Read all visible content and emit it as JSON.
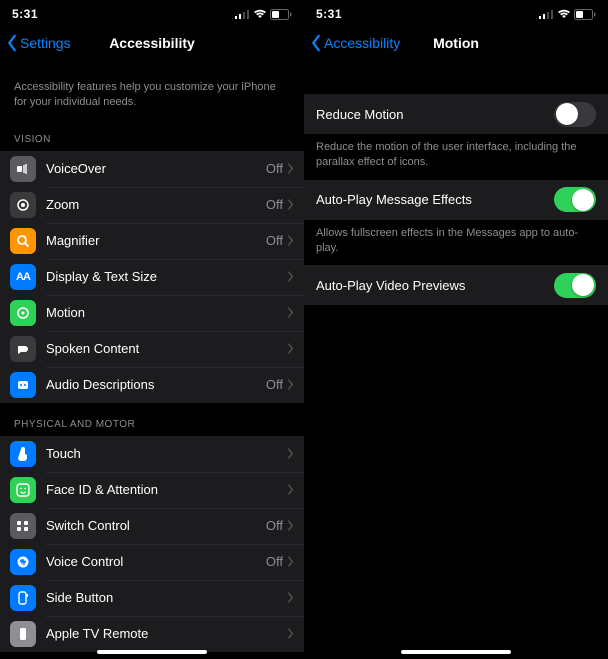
{
  "statusbar": {
    "time": "5:31"
  },
  "left": {
    "back": "Settings",
    "title": "Accessibility",
    "intro": "Accessibility features help you customize your iPhone for your individual needs.",
    "sections": {
      "vision": {
        "header": "VISION",
        "rows": [
          {
            "label": "VoiceOver",
            "value": "Off"
          },
          {
            "label": "Zoom",
            "value": "Off"
          },
          {
            "label": "Magnifier",
            "value": "Off"
          },
          {
            "label": "Display & Text Size",
            "value": ""
          },
          {
            "label": "Motion",
            "value": ""
          },
          {
            "label": "Spoken Content",
            "value": ""
          },
          {
            "label": "Audio Descriptions",
            "value": "Off"
          }
        ]
      },
      "motor": {
        "header": "PHYSICAL AND MOTOR",
        "rows": [
          {
            "label": "Touch",
            "value": ""
          },
          {
            "label": "Face ID & Attention",
            "value": ""
          },
          {
            "label": "Switch Control",
            "value": "Off"
          },
          {
            "label": "Voice Control",
            "value": "Off"
          },
          {
            "label": "Side Button",
            "value": ""
          },
          {
            "label": "Apple TV Remote",
            "value": ""
          }
        ]
      }
    }
  },
  "right": {
    "back": "Accessibility",
    "title": "Motion",
    "rows": {
      "reduce": {
        "label": "Reduce Motion",
        "on": false,
        "footer": "Reduce the motion of the user interface, including the parallax effect of icons."
      },
      "msgfx": {
        "label": "Auto-Play Message Effects",
        "on": true,
        "footer": "Allows fullscreen effects in the Messages app to auto-play."
      },
      "video": {
        "label": "Auto-Play Video Previews",
        "on": true
      }
    }
  }
}
